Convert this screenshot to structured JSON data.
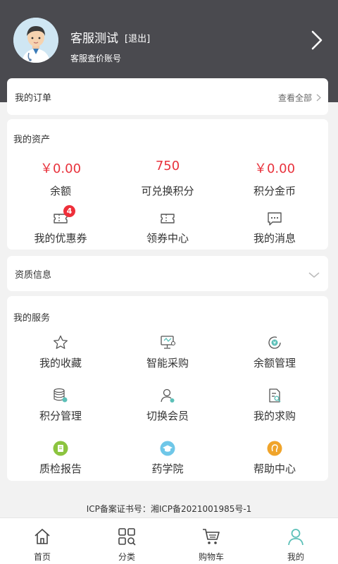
{
  "header": {
    "username": "客服测试",
    "logout_label": "[退出]",
    "subtitle": "客服查价账号",
    "background": "#4a4a4f"
  },
  "orders": {
    "title": "我的订单",
    "view_all": "查看全部"
  },
  "assets": {
    "title": "我的资产",
    "values": [
      {
        "value": "￥0.00",
        "label": "余额"
      },
      {
        "value": "750",
        "label": "可兑换积分"
      },
      {
        "value": "￥0.00",
        "label": "积分金币"
      }
    ],
    "shortcuts": [
      {
        "label": "我的优惠券",
        "icon": "ticket-icon",
        "badge": "4"
      },
      {
        "label": "领券中心",
        "icon": "coupon-center-icon"
      },
      {
        "label": "我的消息",
        "icon": "message-icon"
      }
    ],
    "accent": "#e8323c"
  },
  "qualification": {
    "title": "资质信息"
  },
  "services": {
    "title": "我的服务",
    "items": [
      {
        "label": "我的收藏",
        "icon": "star-icon"
      },
      {
        "label": "智能采购",
        "icon": "smart-purchase-icon"
      },
      {
        "label": "余额管理",
        "icon": "balance-icon"
      },
      {
        "label": "积分管理",
        "icon": "points-icon"
      },
      {
        "label": "切换会员",
        "icon": "switch-member-icon"
      },
      {
        "label": "我的求购",
        "icon": "request-icon"
      },
      {
        "label": "质检报告",
        "icon": "report-icon"
      },
      {
        "label": "药学院",
        "icon": "academy-icon"
      },
      {
        "label": "帮助中心",
        "icon": "help-icon"
      }
    ]
  },
  "footer": {
    "icp": "ICP备案证书号：湘ICP备2021001985号-1"
  },
  "tabbar": {
    "tabs": [
      {
        "label": "首页",
        "icon": "home-icon"
      },
      {
        "label": "分类",
        "icon": "category-icon"
      },
      {
        "label": "购物车",
        "icon": "cart-icon"
      },
      {
        "label": "我的",
        "icon": "user-icon",
        "active": true
      }
    ],
    "active_color": "#5cc0b8"
  }
}
